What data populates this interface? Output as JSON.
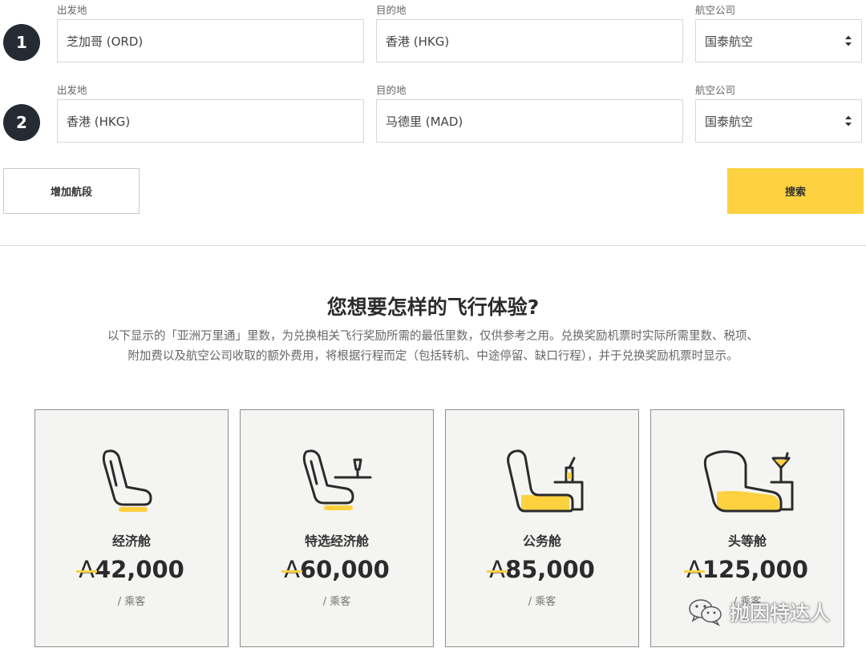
{
  "segments": [
    {
      "number": "1",
      "origin": {
        "label": "出发地",
        "value": "芝加哥 (ORD)"
      },
      "destination": {
        "label": "目的地",
        "value": "香港 (HKG)"
      },
      "airline": {
        "label": "航空公司",
        "value": "国泰航空"
      }
    },
    {
      "number": "2",
      "origin": {
        "label": "出发地",
        "value": "香港 (HKG)"
      },
      "destination": {
        "label": "目的地",
        "value": "马德里 (MAD)"
      },
      "airline": {
        "label": "航空公司",
        "value": "国泰航空"
      }
    }
  ],
  "actions": {
    "add_segment": "增加航段",
    "search": "搜索"
  },
  "experience": {
    "title": "您想要怎样的飞行体验?",
    "desc_line1": "以下显示的「亚洲万里通」里数，为兑换相关飞行奖励所需的最低里数，仅供参考之用。兑换奖励机票时实际所需里数、税项、",
    "desc_line2": "附加费以及航空公司收取的额外费用，将根据行程而定（包括转机、中途停留、缺口行程），并于兑换奖励机票时显示。"
  },
  "cabins": [
    {
      "name": "经济舱",
      "currency": "A",
      "miles": "42,000",
      "unit": "/ 乘客",
      "icon": "economy-seat-icon"
    },
    {
      "name": "特选经济舱",
      "currency": "A",
      "miles": "60,000",
      "unit": "/ 乘客",
      "icon": "premium-economy-seat-icon"
    },
    {
      "name": "公务舱",
      "currency": "A",
      "miles": "85,000",
      "unit": "/ 乘客",
      "icon": "business-seat-icon"
    },
    {
      "name": "头等舱",
      "currency": "A",
      "miles": "125,000",
      "unit": "/ 乘客",
      "icon": "first-class-seat-icon"
    }
  ],
  "watermark": {
    "text": "抛因特达人",
    "icon": "wechat-icon"
  },
  "colors": {
    "accent": "#fdd13f",
    "badge": "#262b33",
    "card_bg": "#f4f4f2"
  }
}
